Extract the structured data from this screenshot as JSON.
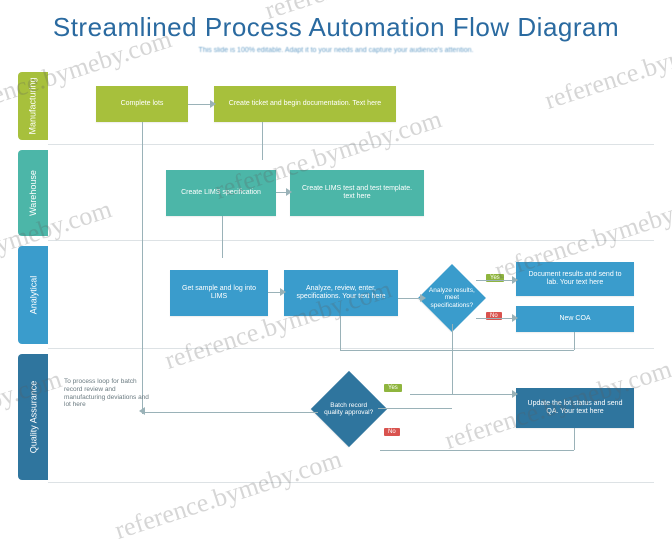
{
  "title": "Streamlined Process Automation Flow Diagram",
  "subtitle": "This slide is 100% editable. Adapt it to your needs and capture your audience's attention.",
  "lanes": {
    "l1": "Manufacturing",
    "l2": "Warehouse",
    "l3": "Analytical",
    "l4": "Quality Assurance"
  },
  "nodes": {
    "n1": "Complete lots",
    "n2": "Create ticket and begin documentation. Text here",
    "n3": "Create LIMS specification",
    "n4": "Create LIMS test and test template. text here",
    "n5": "Get sample and log into LIMS",
    "n6": "Analyze, review, enter, specifications. Your text here",
    "n7": "Analyze results, meet specifications?",
    "n8": "Document results and send to lab. Your text here",
    "n9": "New COA",
    "n10": "Batch record quality approval?",
    "n11": "Update the lot status and send QA. Your text here"
  },
  "note": "To process loop for batch record review and manufacturing deviations and lot here",
  "tags": {
    "yes": "Yes",
    "no": "No"
  },
  "watermark": "reference.bymeby.com"
}
